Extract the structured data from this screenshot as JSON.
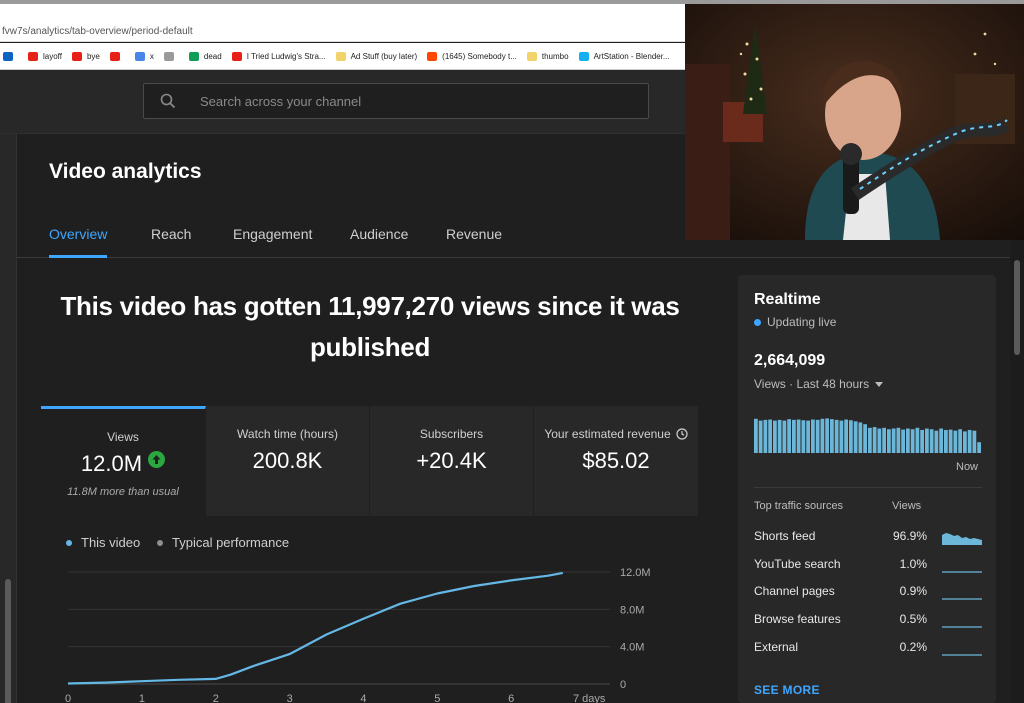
{
  "browser": {
    "url": "fvw7s/analytics/tab-overview/period-default",
    "bookmarks": [
      {
        "label": "",
        "icon": "outlook-icon",
        "color": "#0a64c2"
      },
      {
        "label": "layoff",
        "icon": "youtube-icon",
        "color": "#e62117"
      },
      {
        "label": "bye",
        "icon": "youtube-icon",
        "color": "#e62117"
      },
      {
        "label": "",
        "icon": "youtube-icon",
        "color": "#e62117"
      },
      {
        "label": "x",
        "icon": "docs-icon",
        "color": "#4a86e8"
      },
      {
        "label": "",
        "icon": "cloud-icon",
        "color": "#9a9a9a"
      },
      {
        "label": "dead",
        "icon": "sheets-icon",
        "color": "#0f9d58"
      },
      {
        "label": "I Tried Ludwig's Stra...",
        "icon": "youtube-icon",
        "color": "#e62117"
      },
      {
        "label": "Ad Stuff (buy later)",
        "icon": "folder-icon",
        "color": "#f2d36b"
      },
      {
        "label": "(1645) Somebody t...",
        "icon": "reddit-icon",
        "color": "#ff4500"
      },
      {
        "label": "thumbo",
        "icon": "folder-icon",
        "color": "#f2d36b"
      },
      {
        "label": "ArtStation - Blender...",
        "icon": "artstation-icon",
        "color": "#13aff0"
      }
    ]
  },
  "header": {
    "search_placeholder": "Search across your channel"
  },
  "page": {
    "title": "Video analytics",
    "tabs": [
      {
        "label": "Overview",
        "active": true
      },
      {
        "label": "Reach",
        "active": false
      },
      {
        "label": "Engagement",
        "active": false
      },
      {
        "label": "Audience",
        "active": false
      },
      {
        "label": "Revenue",
        "active": false
      }
    ],
    "headline": "This video has gotten 11,997,270 views since it was published"
  },
  "metrics": [
    {
      "label": "Views",
      "value": "12.0M",
      "note": "11.8M more than usual",
      "trend": "up"
    },
    {
      "label": "Watch time (hours)",
      "value": "200.8K",
      "note": ""
    },
    {
      "label": "Subscribers",
      "value": "+20.4K",
      "note": ""
    },
    {
      "label": "Your estimated revenue",
      "value": "$85.02",
      "note": "",
      "icon": "clock-icon"
    }
  ],
  "chart_data": {
    "type": "line",
    "legend": [
      {
        "name": "This video",
        "color": "#65b8e6"
      },
      {
        "name": "Typical performance",
        "color": "#909090"
      }
    ],
    "series": [
      {
        "name": "This video",
        "x": [
          0,
          0.5,
          1,
          1.5,
          2,
          2.2,
          2.5,
          3,
          3.5,
          4,
          4.5,
          5,
          5.5,
          6,
          6.5,
          6.7
        ],
        "y": [
          0.05,
          0.15,
          0.3,
          0.45,
          0.55,
          1.0,
          1.9,
          3.2,
          5.3,
          7.0,
          8.6,
          9.7,
          10.5,
          11.1,
          11.6,
          11.9
        ]
      }
    ],
    "x_ticks": [
      "0",
      "1",
      "2",
      "3",
      "4",
      "5",
      "6",
      "7 days"
    ],
    "y_ticks": [
      "12.0M",
      "8.0M",
      "4.0M",
      "0"
    ],
    "xlim": [
      0,
      7
    ],
    "ylim": [
      0,
      12
    ],
    "grid": true
  },
  "realtime": {
    "title": "Realtime",
    "status": "Updating live",
    "count": "2,664,099",
    "period": "Views · Last 48 hours",
    "now_label": "Now",
    "bars": [
      0.95,
      0.9,
      0.92,
      0.93,
      0.9,
      0.92,
      0.9,
      0.94,
      0.92,
      0.93,
      0.91,
      0.9,
      0.93,
      0.92,
      0.95,
      0.96,
      0.94,
      0.92,
      0.9,
      0.93,
      0.91,
      0.88,
      0.85,
      0.8,
      0.7,
      0.72,
      0.68,
      0.7,
      0.66,
      0.68,
      0.7,
      0.65,
      0.68,
      0.66,
      0.7,
      0.64,
      0.68,
      0.66,
      0.62,
      0.68,
      0.64,
      0.65,
      0.62,
      0.66,
      0.6,
      0.64,
      0.62,
      0.3
    ],
    "sources_header": "Top traffic sources",
    "sources_views_header": "Views",
    "sources": [
      {
        "name": "Shorts feed",
        "pct": "96.9%"
      },
      {
        "name": "YouTube search",
        "pct": "1.0%"
      },
      {
        "name": "Channel pages",
        "pct": "0.9%"
      },
      {
        "name": "Browse features",
        "pct": "0.5%"
      },
      {
        "name": "External",
        "pct": "0.2%"
      }
    ],
    "see_more": "SEE MORE"
  }
}
